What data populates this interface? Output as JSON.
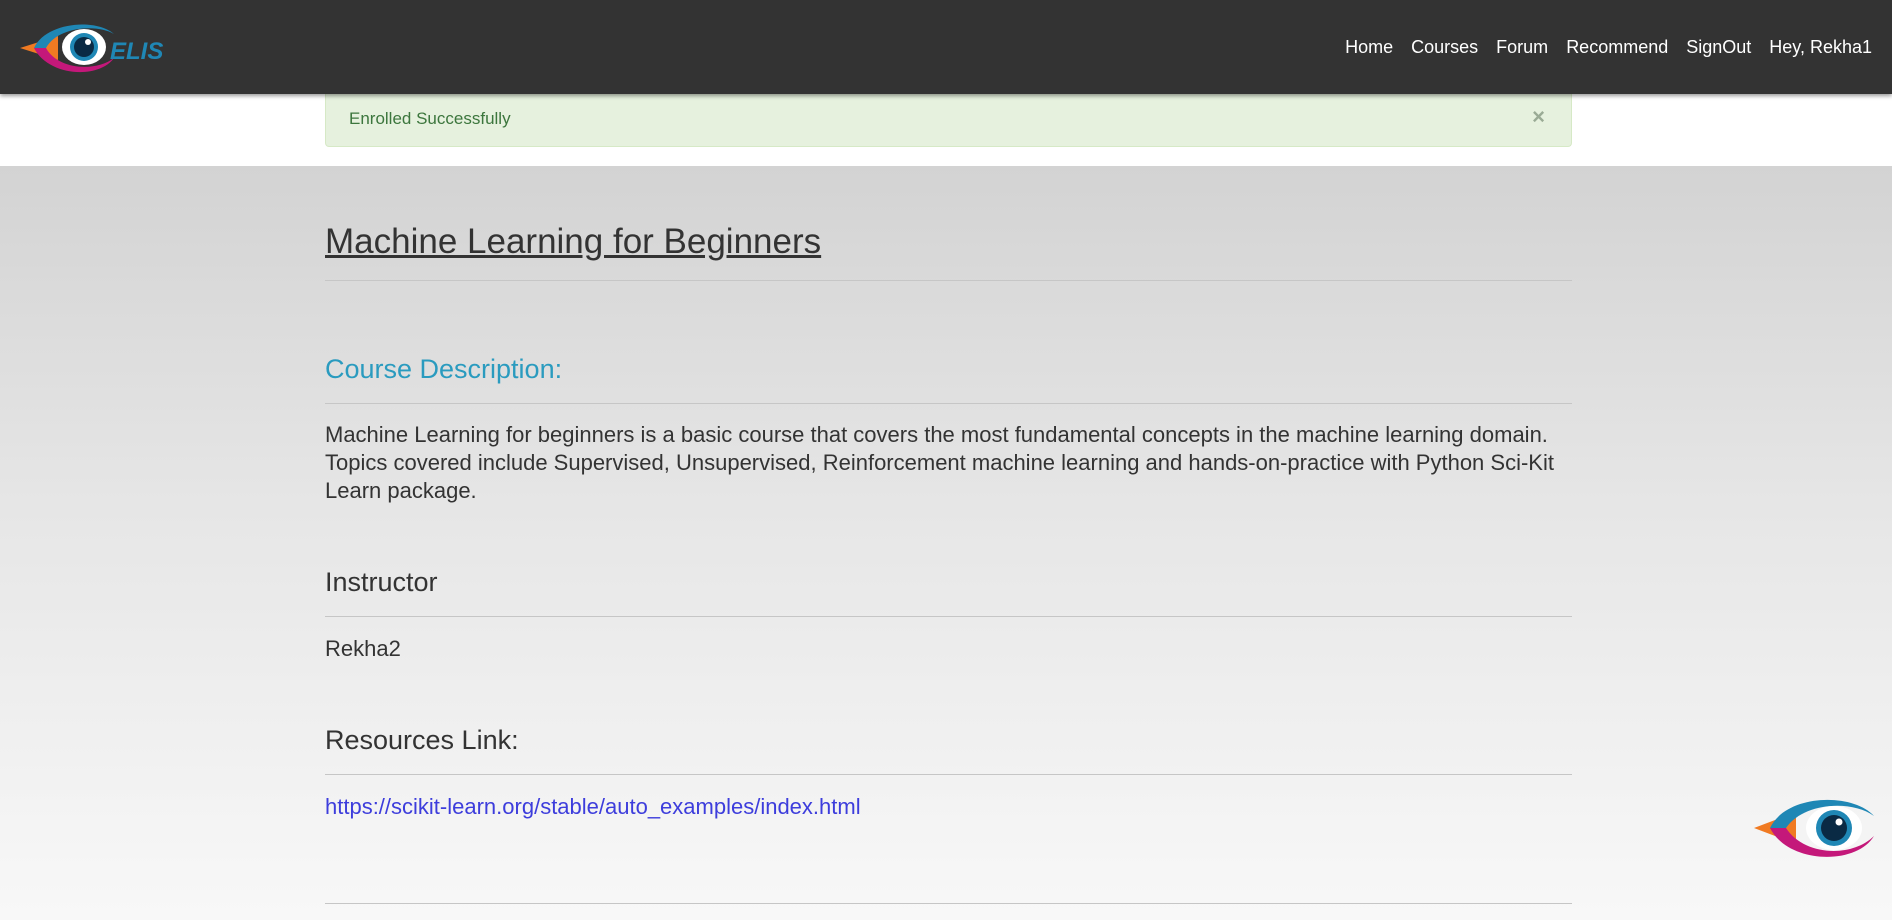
{
  "brand": {
    "logo_text": "ELIS",
    "colors": {
      "navbar": "#333333",
      "eye_teal": "#1f87b5",
      "eye_magenta": "#c4187a",
      "eye_orange": "#f07a22",
      "pupil": "#0a3d66"
    }
  },
  "nav": {
    "items": [
      {
        "label": "Home"
      },
      {
        "label": "Courses"
      },
      {
        "label": "Forum"
      },
      {
        "label": "Recommend"
      },
      {
        "label": "SignOut"
      },
      {
        "label": "Hey, Rekha1"
      }
    ]
  },
  "alert": {
    "message": "Enrolled Successfully",
    "close_glyph": "×"
  },
  "course": {
    "title": "Machine Learning for Beginners",
    "description_heading": "Course Description:",
    "description": "Machine Learning for beginners is a basic course that covers the most fundamental concepts in the machine learning domain. Topics covered include Supervised, Unsupervised, Reinforcement machine learning and hands-on-practice with Python Sci-Kit Learn package.",
    "instructor_heading": "Instructor",
    "instructor_name": "Rekha2",
    "resources_heading": "Resources Link:",
    "resources_url": "https://scikit-learn.org/stable/auto_examples/index.html"
  },
  "floating_widget": {
    "icon": "eye-logo-icon"
  }
}
